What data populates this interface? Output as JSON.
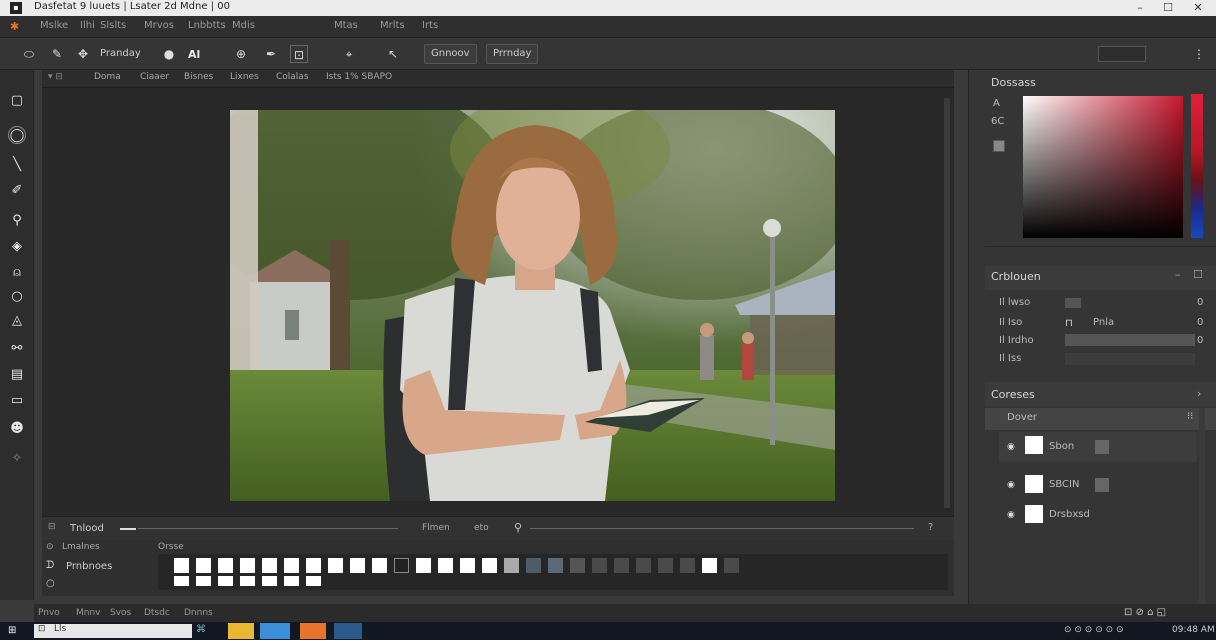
{
  "titlebar": {
    "title": "Dasfetat 9 luuets | Lsater 2d Mdne | 00",
    "minimize": "–",
    "maximize": "☐",
    "close": "✕"
  },
  "menubar": {
    "items": [
      "Mslke",
      "Ilhi",
      "Slslts",
      "Mrvos",
      "Lnbbtts",
      "Mdis",
      "Mtas",
      "Mrlts",
      "Irts"
    ]
  },
  "optionsbar": {
    "mode_label": "Pranday",
    "font_label": "Al",
    "btn1": "Gnnoov",
    "btn2": "Prrnday",
    "search_placeholder": ""
  },
  "doctabs": {
    "tabs": [
      "Doma",
      "Ciaaer",
      "Bisnes",
      "Lixnes",
      "Colalas",
      "Ists 1% SBAPO"
    ]
  },
  "timeline": {
    "label": "Tnlood",
    "mode": "Flmen",
    "value": "eto",
    "end": "?"
  },
  "swatchpanel": {
    "header_left": "Lmalnes",
    "header_right": "Orsse",
    "row_label": "Prnbnoes"
  },
  "rightpanels": {
    "color_title": "Dossass",
    "color_label_a": "A",
    "color_label_b": "6C",
    "prop_title": "Crblouen",
    "prop_rows": [
      {
        "label": "Il lwso",
        "value": "0"
      },
      {
        "label": "Il Iso",
        "tag": "Pnla",
        "value": "0"
      },
      {
        "label": "Il Irdho",
        "value": "0"
      },
      {
        "label": "Il Iss",
        "value": ""
      }
    ],
    "layers_title": "Coreses",
    "layers_sub": "Dover",
    "layers": [
      {
        "name": "Sbon"
      },
      {
        "name": "SBCIN"
      },
      {
        "name": "Drsbxsd"
      }
    ]
  },
  "statusbar": {
    "items": [
      "Pnvo",
      "Mnnv",
      "Svos",
      "Dtsdc",
      "Dnnns"
    ]
  },
  "taskbar": {
    "search_text": "Lls",
    "time": "09:48 AM"
  },
  "colors": {
    "accent": "#e8732a",
    "panel_bg": "#353535"
  }
}
